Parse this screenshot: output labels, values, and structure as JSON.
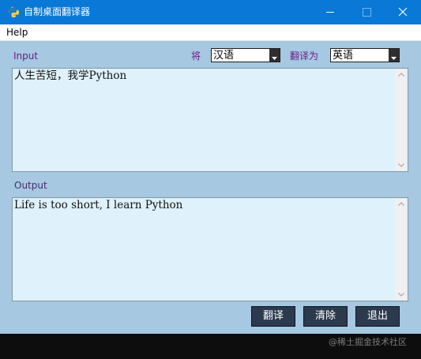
{
  "window": {
    "title": "自制桌面翻译器",
    "icon": "python-logo-icon"
  },
  "menu": {
    "items": [
      "Help"
    ]
  },
  "input_section": {
    "label": "Input",
    "text": "人生苦短，我学Python"
  },
  "translate_row": {
    "from_label": "将",
    "source_lang": "汉语",
    "to_label": "翻译为",
    "target_lang": "英语"
  },
  "output_section": {
    "label": "Output",
    "text": "Life is too short, I learn Python"
  },
  "buttons": {
    "translate": "翻译",
    "clear": "清除",
    "quit": "退出"
  },
  "watermark": "@稀土掘金技术社区",
  "colors": {
    "titlebar": "#0a78d7",
    "window_bg": "#a6c8e1",
    "textbox_bg": "#dff2fb",
    "button_bg": "#2c3a4e",
    "label_purple": "#6a1c88"
  }
}
